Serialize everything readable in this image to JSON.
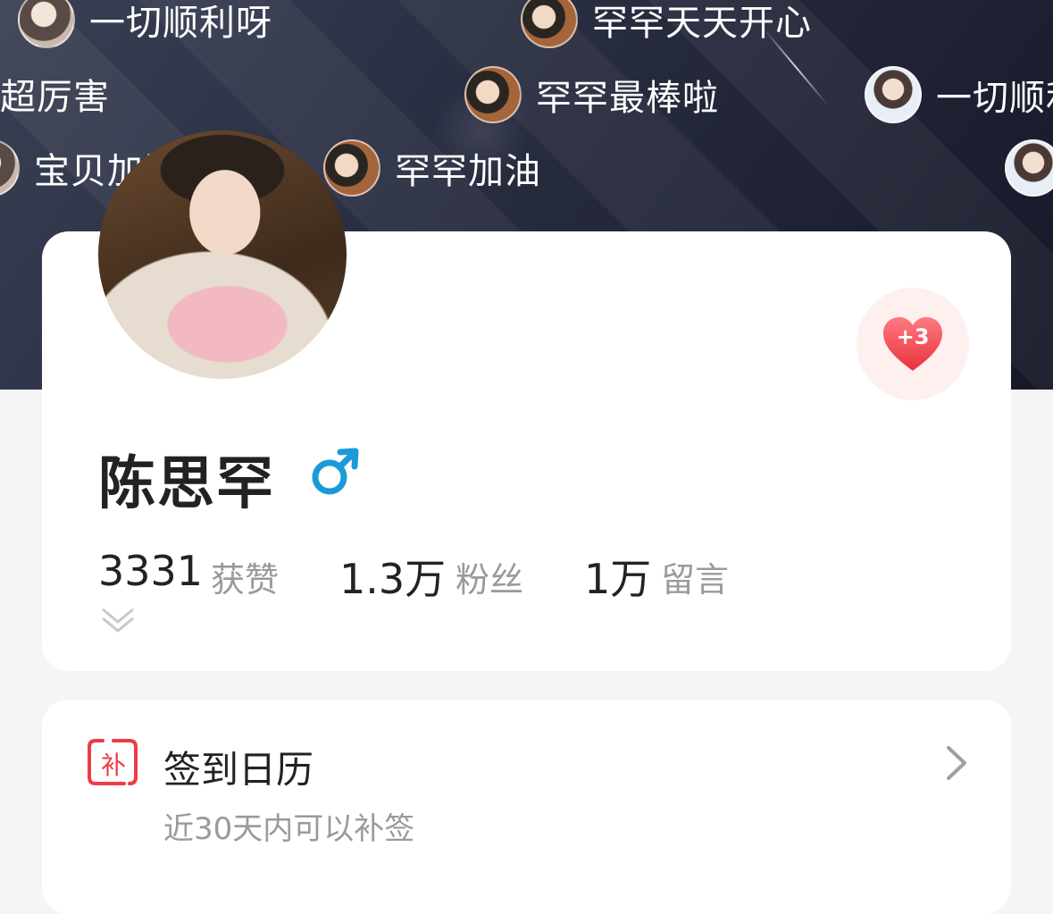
{
  "danmaku": [
    {
      "text": "一切顺利呀",
      "avatar": "avatar-a"
    },
    {
      "text": "罕罕天天开心",
      "avatar": "avatar-b"
    },
    {
      "text": "超厉害",
      "avatar": ""
    },
    {
      "text": "罕罕最棒啦",
      "avatar": "avatar-b"
    },
    {
      "text": "一切顺利",
      "avatar": "avatar-c"
    },
    {
      "text": "宝贝加油",
      "avatar": "avatar-a"
    },
    {
      "text": "罕罕加油",
      "avatar": "avatar-b"
    },
    {
      "text": "",
      "avatar": "avatar-c"
    }
  ],
  "profile": {
    "name": "陈思罕",
    "gender": "male",
    "like_bonus": "+3",
    "stats": [
      {
        "value": "3331",
        "label": "获赞"
      },
      {
        "value": "1.3万",
        "label": "粉丝"
      },
      {
        "value": "1万",
        "label": "留言"
      }
    ]
  },
  "checkin": {
    "icon_char": "补",
    "title": "签到日历",
    "subtitle": "近30天内可以补签"
  },
  "colors": {
    "accent_red": "#ee3b45",
    "male_blue": "#1a9bd7",
    "hero_bg": "#2b3044"
  }
}
